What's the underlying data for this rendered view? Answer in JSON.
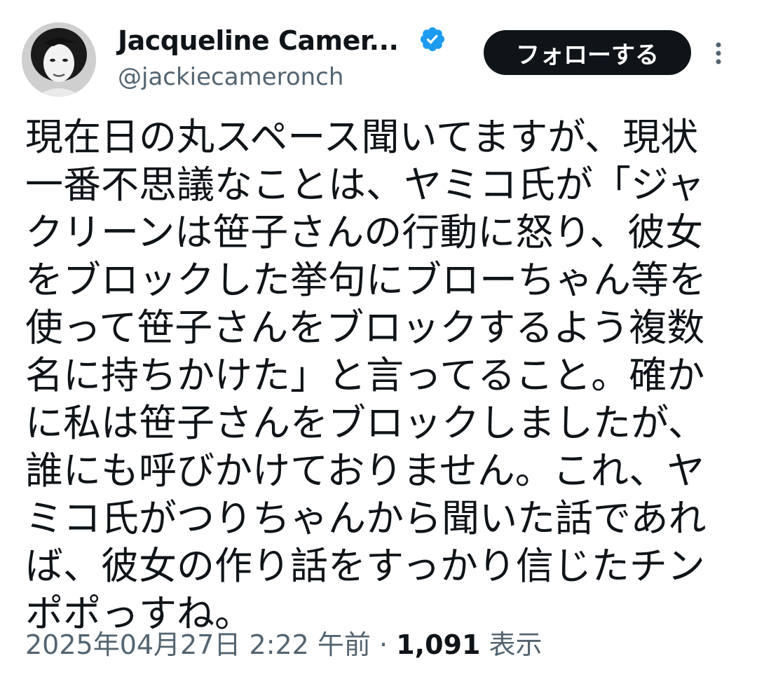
{
  "author": {
    "display_name": "Jacqueline Camer...",
    "handle": "@jackiecameronch",
    "verified": true,
    "avatar_icon": "avatar-portrait"
  },
  "actions": {
    "follow_label": "フォローする",
    "more_icon": "more-vertical-icon"
  },
  "tweet": {
    "text": "現在日の丸スペース聞いてますが、現状一番不思議なことは、ヤミコ氏が「ジャクリーンは笹子さんの行動に怒り、彼女をブロックした挙句にブローちゃん等を使って笹子さんをブロックするよう複数名に持ちかけた」と言ってること。確かに私は笹子さんをブロックしましたが、誰にも呼びかけておりません。これ、ヤミコ氏がつりちゃんから聞いた話であれば、彼女の作り話をすっかり信じたチンポポっすね。"
  },
  "meta": {
    "date": "2025年04月27日",
    "time": "2:22 午前",
    "separator": "·",
    "views_count": "1,091",
    "views_label": "表示"
  },
  "colors": {
    "text": "#0f1419",
    "secondary": "#536471",
    "verified": "#1d9bf0",
    "button_bg": "#0f1419",
    "button_text": "#ffffff"
  }
}
